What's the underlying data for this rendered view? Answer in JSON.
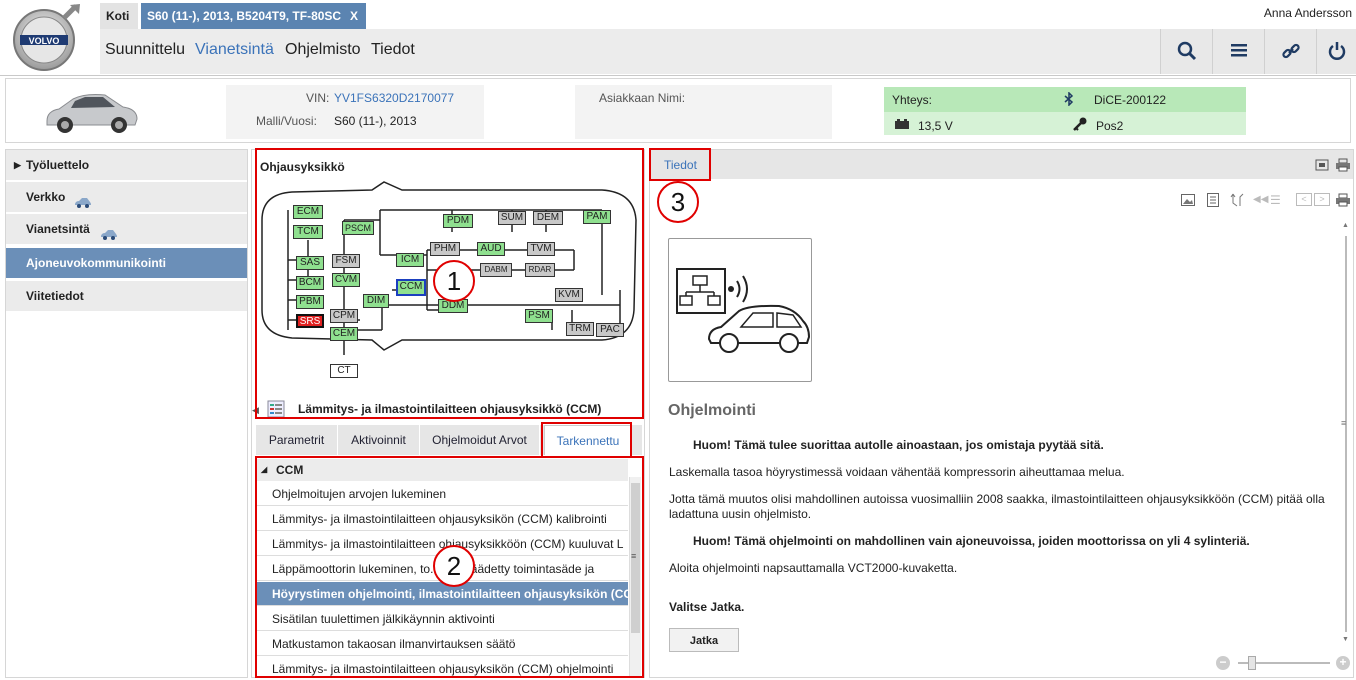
{
  "header": {
    "home_tab": "Koti",
    "vehicle_tab": "S60 (11-), 2013, B5204T9, TF-80SC",
    "vehicle_tab_close": "X",
    "logo_text": "VOLVO",
    "user_name": "Anna Andersson",
    "menu": [
      "Suunnittelu",
      "Vianetsintä",
      "Ohjelmisto",
      "Tiedot"
    ],
    "active_menu": "Vianetsintä",
    "toolbar_icons": [
      "search-icon",
      "list-icon",
      "link-icon",
      "power-icon"
    ]
  },
  "vehicle": {
    "vin_label": "VIN:",
    "vin": "YV1FS6320D2170077",
    "model_label": "Malli/Vuosi:",
    "model": "S60 (11-), 2013",
    "customer_label": "Asiakkaan Nimi:",
    "customer": "",
    "connection_label": "Yhteys:",
    "connection_device": "DiCE-200122",
    "voltage": "13,5 V",
    "key_position": "Pos2",
    "connection_color": "#b8e8b8"
  },
  "left_nav": {
    "items": [
      {
        "label": "Työluettelo"
      },
      {
        "label": "Verkko"
      },
      {
        "label": "Vianetsintä"
      },
      {
        "label": "Ajoneuvokommunikointi"
      },
      {
        "label": "Viitetiedot"
      }
    ],
    "active": "Ajoneuvokommunikointi"
  },
  "ecu_panel": {
    "title": "Ohjausyksikkö",
    "selected_name": "Lämmitys- ja ilmastointilaitteen ohjausyksikkö (CCM)",
    "ecus": [
      "ECM",
      "TCM",
      "PSCM",
      "PDM",
      "SUM",
      "DEM",
      "PAM",
      "SAS",
      "FSM",
      "ICM",
      "PHM",
      "AUD",
      "TVM",
      "BCM",
      "CVM",
      "CCM",
      "DABM",
      "RDAR",
      "KVM",
      "PBM",
      "DIM",
      "DDM",
      "PSM",
      "SRS",
      "CPM",
      "CEM",
      "TRM",
      "PAC",
      "CT"
    ],
    "sub_tabs": [
      "Parametrit",
      "Aktivoinnit",
      "Ohjelmoidut Arvot",
      "Tarkennettu"
    ],
    "active_sub_tab": "Tarkennettu",
    "list_header": "CCM",
    "list_items": [
      "Ohjelmoitujen arvojen lukeminen",
      "Lämmitys- ja ilmastointilaitteen ohjausyksikön (CCM) kalibrointi",
      "Lämmitys- ja ilmastointilaitteen ohjausyksikköön (CCM) kuuluvat L",
      "Läppämoottorin lukeminen, to... vesisäädetty toimintasäde ja",
      "Höyrystimen ohjelmointi, ilmastointilaitteen ohjausyksikön (CCM)",
      "Sisätilan tuulettimen jälkikäynnin aktivointi",
      "Matkustamon takaosan ilmanvirtauksen säätö",
      "Lämmitys- ja ilmastointilaitteen ohjausyksikön (CCM) ohjelmointi"
    ],
    "active_item_index": 4
  },
  "info_panel": {
    "tab": "Tiedot",
    "heading": "Ohjelmointi",
    "warning1": "Huom! Tämä tulee suorittaa autolle ainoastaan, jos omistaja pyytää sitä.",
    "para1": "Laskemalla tasoa höyrystimessä voidaan vähentää kompressorin aiheuttamaa melua.",
    "para2": "Jotta tämä muutos olisi mahdollinen autoissa vuosimalliin 2008 saakka, ilmastointilaitteen ohjausyksikköön (CCM) pitää olla ladattuna uusin ohjelmisto.",
    "warning2": "Huom! Tämä ohjelmointi on mahdollinen vain ajoneuvoissa, joiden moottorissa on yli 4 sylinteriä.",
    "para3": "Aloita ohjelmointi napsauttamalla VCT2000-kuvaketta.",
    "next_label": "Valitse Jatka.",
    "continue_button": "Jatka"
  },
  "annotations": {
    "markers": [
      "1",
      "2",
      "3"
    ],
    "color": "#e00000"
  }
}
